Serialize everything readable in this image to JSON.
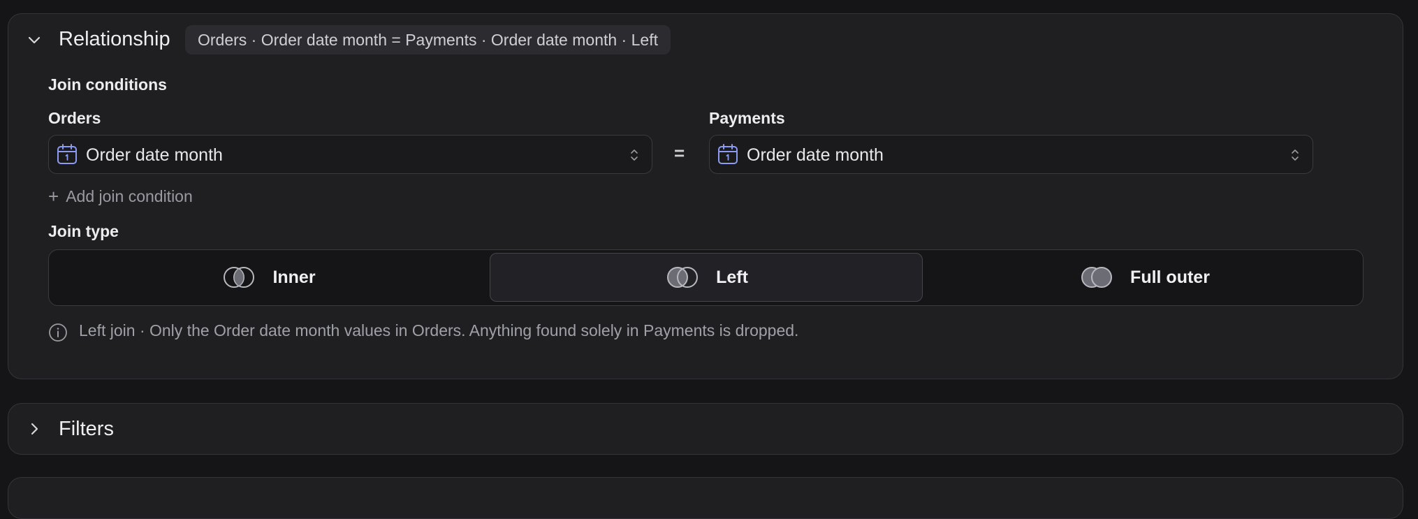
{
  "relationship": {
    "title": "Relationship",
    "summary": "Orders · Order date month = Payments · Order date month · Left",
    "join_conditions_label": "Join conditions",
    "left_table": "Orders",
    "right_table": "Payments",
    "left_field": "Order date month",
    "right_field": "Order date month",
    "equals": "=",
    "add_condition_label": "Add join condition",
    "join_type_label": "Join type",
    "join_types": [
      {
        "label": "Inner",
        "selected": false
      },
      {
        "label": "Left",
        "selected": true
      },
      {
        "label": "Full outer",
        "selected": false
      }
    ],
    "info_text": "Left join · Only the Order date month values in Orders. Anything found solely in Payments is dropped.",
    "icons": {
      "calendar": "calendar-icon",
      "updown": "chevron-up-down-icon",
      "collapse": "chevron-down-icon",
      "info": "info-icon"
    },
    "accent_color": "#8b9cf0"
  },
  "filters": {
    "title": "Filters",
    "icon": "chevron-right-icon"
  }
}
